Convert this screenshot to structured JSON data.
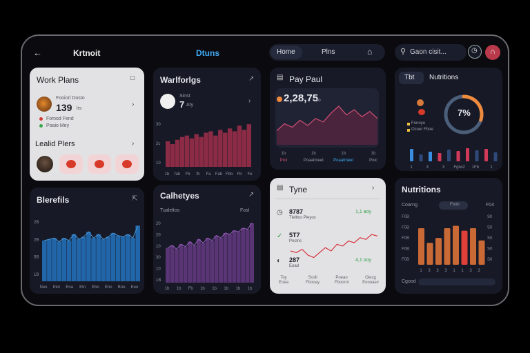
{
  "header": {
    "back_icon": "arrow-left-icon",
    "app_name": "Krtnoit",
    "center_title": "Dtuns",
    "nav": [
      "Home",
      "Plns"
    ],
    "home_icon": "house-icon",
    "search_placeholder": "Gaon cisit...",
    "accent": "#3fa9f5"
  },
  "work_plans": {
    "title": "Work Plans",
    "item_name": "Fooiorl Dosto",
    "value": "139",
    "unit": "lrs",
    "legend": [
      "Fomod Fend",
      "Poaio Mey"
    ],
    "legend_colors": [
      "#d33a3a",
      "#3aa64a"
    ],
    "sub_title": "Lealid Plers",
    "item_icon": "tomato-icon"
  },
  "workflow": {
    "title": "Warlforlgs",
    "item_label": "Sinst",
    "value": "7",
    "unit": "Aty",
    "chart_data": {
      "type": "bar",
      "color": "#8c2b45",
      "values": [
        18,
        16,
        19,
        21,
        22,
        20,
        23,
        21,
        24,
        25,
        22,
        26,
        24,
        27,
        25,
        29,
        26,
        30
      ],
      "y_ticks": [
        "30",
        "2c",
        "10"
      ],
      "x_ticks": [
        "1b",
        "fab",
        "Fb",
        "fb",
        "Fa",
        "Fab",
        "Fbb",
        "Fb",
        "Fe"
      ]
    }
  },
  "pay_panel": {
    "title": "Pay Paul",
    "value": "2,28,75",
    "unit": "ao",
    "chart_data": {
      "type": "area",
      "color": "#d14f73",
      "values": [
        8,
        12,
        10,
        14,
        11,
        15,
        13,
        18,
        22,
        17,
        20,
        16,
        19,
        15
      ],
      "x_ticks": [
        "1b",
        "1b",
        "1b",
        "1b"
      ],
      "x_labels": [
        "Prol",
        "Poaatmeet",
        "Poaatmeet",
        "Poic"
      ],
      "x_label_colors": [
        "#d14f73",
        "#9a9caa",
        "#3fa9f5",
        "#9a9caa"
      ]
    }
  },
  "nutrition_top": {
    "tabs": [
      "Tbt",
      "Nutritions"
    ],
    "gauge_value": "7%",
    "gauge_fraction": 0.3,
    "gauge_colors": [
      "#f08a3c",
      "#4b5f7a"
    ],
    "legend": [
      "Fonoyo",
      "Ocoer Fboe"
    ],
    "chart_data": {
      "type": "bar",
      "values": [
        18,
        10,
        14,
        12,
        17,
        15,
        19,
        16,
        18,
        13,
        20
      ],
      "colors": [
        "#3a8ee0",
        "#2f4a7a",
        "#3a8ee0",
        "#d33a5a",
        "#2f4a7a",
        "#d33a5a",
        "#d33a5a",
        "#2f4a7a",
        "#d33a5a",
        "#2f4a7a",
        "#d33a5a"
      ],
      "x_ticks": [
        "1",
        "3",
        "3",
        "Fgtw2",
        "1Fb",
        "1"
      ]
    }
  },
  "benefits": {
    "title": "Blerefils",
    "chart_data": {
      "type": "bar",
      "color": "#2266aa",
      "values": [
        33,
        34,
        35,
        32,
        35,
        33,
        38,
        34,
        36,
        40,
        35,
        38,
        34,
        36,
        39,
        37,
        36,
        38,
        35,
        45
      ],
      "y_ticks": [
        "2B",
        "2B",
        "5B",
        "1B"
      ],
      "x_ticks": [
        "Neo",
        "Eiol",
        "Ena",
        "Etn",
        "Ebo",
        "Eno",
        "Bno",
        "Eeo"
      ]
    }
  },
  "calories": {
    "title": "Calhetyes",
    "subtitle": "Tualeltos",
    "right_label": "Fosl",
    "chart_data": {
      "type": "bar",
      "color": "#5a3575",
      "values": [
        28,
        30,
        27,
        31,
        29,
        33,
        30,
        35,
        32,
        36,
        34,
        38,
        36,
        40,
        39,
        42,
        41,
        44,
        43,
        48
      ],
      "y_ticks": [
        "20",
        "20",
        "10",
        "30",
        "10",
        "1B"
      ],
      "x_ticks": [
        "1b",
        "1b",
        "Fb",
        "1b",
        "1b",
        "1b",
        "1b",
        "1b"
      ]
    }
  },
  "tyne": {
    "title": "Tyne",
    "rows": [
      {
        "value": "8787",
        "label": "Tleltlos Pleyos",
        "right": "1,1 aoy",
        "icon": "clock-icon",
        "right_color": "#2f9e46"
      },
      {
        "value": "5T7",
        "label": "Pnclns",
        "right": "",
        "icon": "check-circle-icon",
        "right_color": "#2f9e46"
      },
      {
        "value": "287",
        "label": "Eoad",
        "right": "4,1 ooy",
        "icon": "gauge-icon",
        "right_color": "#2f9e46"
      }
    ],
    "chart_data": {
      "type": "line",
      "color": "#d6303a",
      "values": [
        20,
        18,
        22,
        15,
        12,
        18,
        24,
        20,
        28,
        26,
        32,
        30,
        36,
        34,
        40,
        38
      ],
      "x_labels": [
        "Toy\nEoea",
        "Sroill\nFbooay",
        "Poeao\nFboorol",
        "Oiezg\nEoooaev"
      ]
    }
  },
  "nutritions": {
    "title": "Nutritions",
    "left_label": "Coarng",
    "pill_label": "Fbob",
    "right_label": "F04",
    "bottom_label": "Cgood",
    "chart_data": {
      "type": "bar",
      "values": [
        30,
        18,
        22,
        30,
        32,
        28,
        30,
        20
      ],
      "colors": [
        "#c96a36",
        "#c96a36",
        "#c96a36",
        "#c96a36",
        "#c96a36",
        "#e0403a",
        "#c96a36",
        "#c96a36"
      ],
      "y_ticks": [
        "F0B",
        "F0B",
        "F0B",
        "F0B",
        "F0B"
      ],
      "y_ticks_right": [
        "S0",
        "S0",
        "S0",
        "S0",
        "S0"
      ],
      "x_ticks": [
        "1",
        "3",
        "3",
        "3",
        "1",
        "1",
        "3",
        "3"
      ]
    }
  }
}
